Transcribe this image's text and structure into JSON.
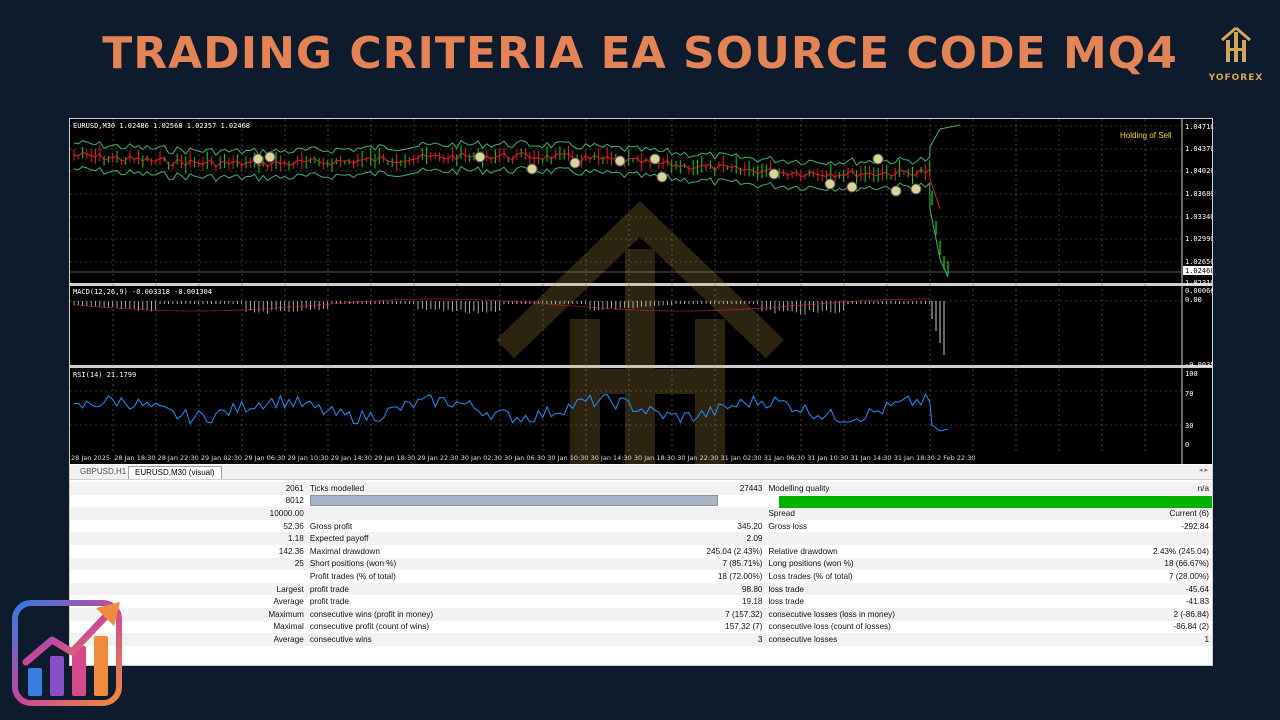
{
  "title": "TRADING CRITERIA EA SOURCE CODE MQ4",
  "brand": {
    "name": "YOFOREX",
    "color": "#d4a657"
  },
  "watermark": {
    "text": "YOFOREX"
  },
  "chart": {
    "symbol_header": "EURUSD,M30  1.02486 1.02568 1.02357 1.02468",
    "status_label": "Holding of Sell",
    "price_labels": [
      "1.04710",
      "1.04370",
      "1.04020",
      "1.03680",
      "1.03340",
      "1.02990",
      "1.02650",
      "1.02468",
      "1.02310"
    ],
    "current_price": "1.02468",
    "macd_header": "MACD(12,26,9) -0.003318 -0.001304",
    "macd_labels": [
      "0.00066",
      "0.00",
      "-0.00358"
    ],
    "rsi_header": "RSI(14) 21.1799",
    "rsi_labels": [
      "100",
      "70",
      "30",
      "0"
    ],
    "time_labels": [
      "28 Jan 2025",
      "28 Jan 18:30",
      "28 Jan 22:30",
      "29 Jan 02:30",
      "29 Jan 06:30",
      "29 Jan 10:30",
      "29 Jan 14:30",
      "29 Jan 18:30",
      "29 Jan 22:30",
      "30 Jan 02:30",
      "30 Jan 06:30",
      "30 Jan 10:30",
      "30 Jan 14:30",
      "30 Jan 18:30",
      "30 Jan 22:30",
      "31 Jan 02:30",
      "31 Jan 06:30",
      "31 Jan 10:30",
      "31 Jan 14:30",
      "31 Jan 18:30",
      "2 Feb 22:30"
    ],
    "colors": {
      "background": "#000000",
      "bullish": "#00e000",
      "bearish": "#e02020",
      "bands": "#3cb371",
      "rsi": "#1e90ff"
    }
  },
  "tabs": [
    {
      "label": "GBPUSD,H1",
      "active": false
    },
    {
      "label": "EURUSD,M30 (visual)",
      "active": true
    }
  ],
  "report": {
    "rows": [
      {
        "c1": "2061",
        "c2": "Ticks modelled",
        "c3": "27443",
        "c4": "Modelling quality",
        "c5": "n/a"
      },
      {
        "c1": "8012",
        "c2": "",
        "c3": "",
        "c4": "",
        "c5": ""
      },
      {
        "c1": "10000.00",
        "c2": "",
        "c3": "",
        "c4": "Spread",
        "c5": "Current (6)"
      },
      {
        "c1": "52.36",
        "c2": "Gross profit",
        "c3": "345.20",
        "c4": "Gross loss",
        "c5": "-292.84"
      },
      {
        "c1": "1.18",
        "c2": "Expected payoff",
        "c3": "2.09",
        "c4": "",
        "c5": ""
      },
      {
        "c1": "142.36",
        "c2": "Maximal drawdown",
        "c3": "245.04 (2.43%)",
        "c4": "Relative drawdown",
        "c5": "2.43% (245.04)"
      },
      {
        "c1": "25",
        "c2": "Short positions (won %)",
        "c3": "7 (85.71%)",
        "c4": "Long positions (won %)",
        "c5": "18 (66.67%)"
      },
      {
        "c1": "",
        "c2": "Profit trades (% of total)",
        "c3": "18 (72.00%)",
        "c4": "Loss trades (% of total)",
        "c5": "7 (28.00%)"
      },
      {
        "c1": "Largest",
        "c2": "profit trade",
        "c3": "98.80",
        "c4": "loss trade",
        "c5": "-45.64"
      },
      {
        "c1": "Average",
        "c2": "profit trade",
        "c3": "19.18",
        "c4": "loss trade",
        "c5": "-41.83"
      },
      {
        "c1": "Maximum",
        "c2": "consecutive wins (profit in money)",
        "c3": "7 (157.32)",
        "c4": "consecutive losses (loss in money)",
        "c5": "2 (-86.84)"
      },
      {
        "c1": "Maximal",
        "c2": "consecutive profit (count of wins)",
        "c3": "157.32 (7)",
        "c4": "consecutive loss (count of losses)",
        "c5": "-86.84 (2)"
      },
      {
        "c1": "Average",
        "c2": "consecutive wins",
        "c3": "3",
        "c4": "consecutive losses",
        "c5": "1"
      }
    ],
    "modelling_quality_fill": 0.9
  }
}
